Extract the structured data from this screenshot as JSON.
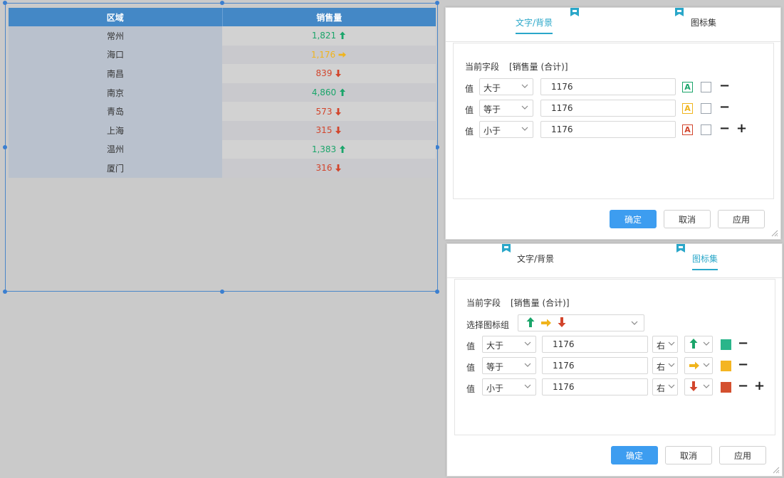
{
  "table": {
    "headers": [
      "区域",
      "销售量"
    ],
    "rows": [
      {
        "region": "常州",
        "value": "1,821",
        "trend": "up"
      },
      {
        "region": "海口",
        "value": "1,176",
        "trend": "right"
      },
      {
        "region": "南昌",
        "value": "839",
        "trend": "down"
      },
      {
        "region": "南京",
        "value": "4,860",
        "trend": "up"
      },
      {
        "region": "青岛",
        "value": "573",
        "trend": "down"
      },
      {
        "region": "上海",
        "value": "315",
        "trend": "down"
      },
      {
        "region": "温州",
        "value": "1,383",
        "trend": "up"
      },
      {
        "region": "厦门",
        "value": "316",
        "trend": "down"
      }
    ]
  },
  "colors": {
    "up": "#1aa56a",
    "right": "#f0b41c",
    "down": "#d2452c",
    "accent": "#2aa7c9",
    "primary": "#3d9df0",
    "swatch_up": "#2ab58a",
    "swatch_equal": "#f4b522",
    "swatch_down": "#d4502f"
  },
  "dialog1": {
    "tabs": [
      "文字/背景",
      "图标集"
    ],
    "active_tab": 0,
    "field_label": "当前字段",
    "field_value": "[销售量 (合计)]",
    "value_label": "值",
    "rules": [
      {
        "op": "大于",
        "value": "1176",
        "a_color": "#1aa56a"
      },
      {
        "op": "等于",
        "value": "1176",
        "a_color": "#f0b41c"
      },
      {
        "op": "小于",
        "value": "1176",
        "a_color": "#d2452c"
      }
    ],
    "a_letter": "A",
    "buttons": {
      "ok": "确定",
      "cancel": "取消",
      "apply": "应用"
    }
  },
  "dialog2": {
    "tabs": [
      "文字/背景",
      "图标集"
    ],
    "active_tab": 1,
    "field_label": "当前字段",
    "field_value": "[销售量 (合计)]",
    "icon_group_label": "选择图标组",
    "value_label": "值",
    "rules": [
      {
        "op": "大于",
        "value": "1176",
        "pos": "右",
        "icon": "up",
        "swatch": "#2ab58a"
      },
      {
        "op": "等于",
        "value": "1176",
        "pos": "右",
        "icon": "right",
        "swatch": "#f4b522"
      },
      {
        "op": "小于",
        "value": "1176",
        "pos": "右",
        "icon": "down",
        "swatch": "#d4502f"
      }
    ],
    "buttons": {
      "ok": "确定",
      "cancel": "取消",
      "apply": "应用"
    }
  }
}
